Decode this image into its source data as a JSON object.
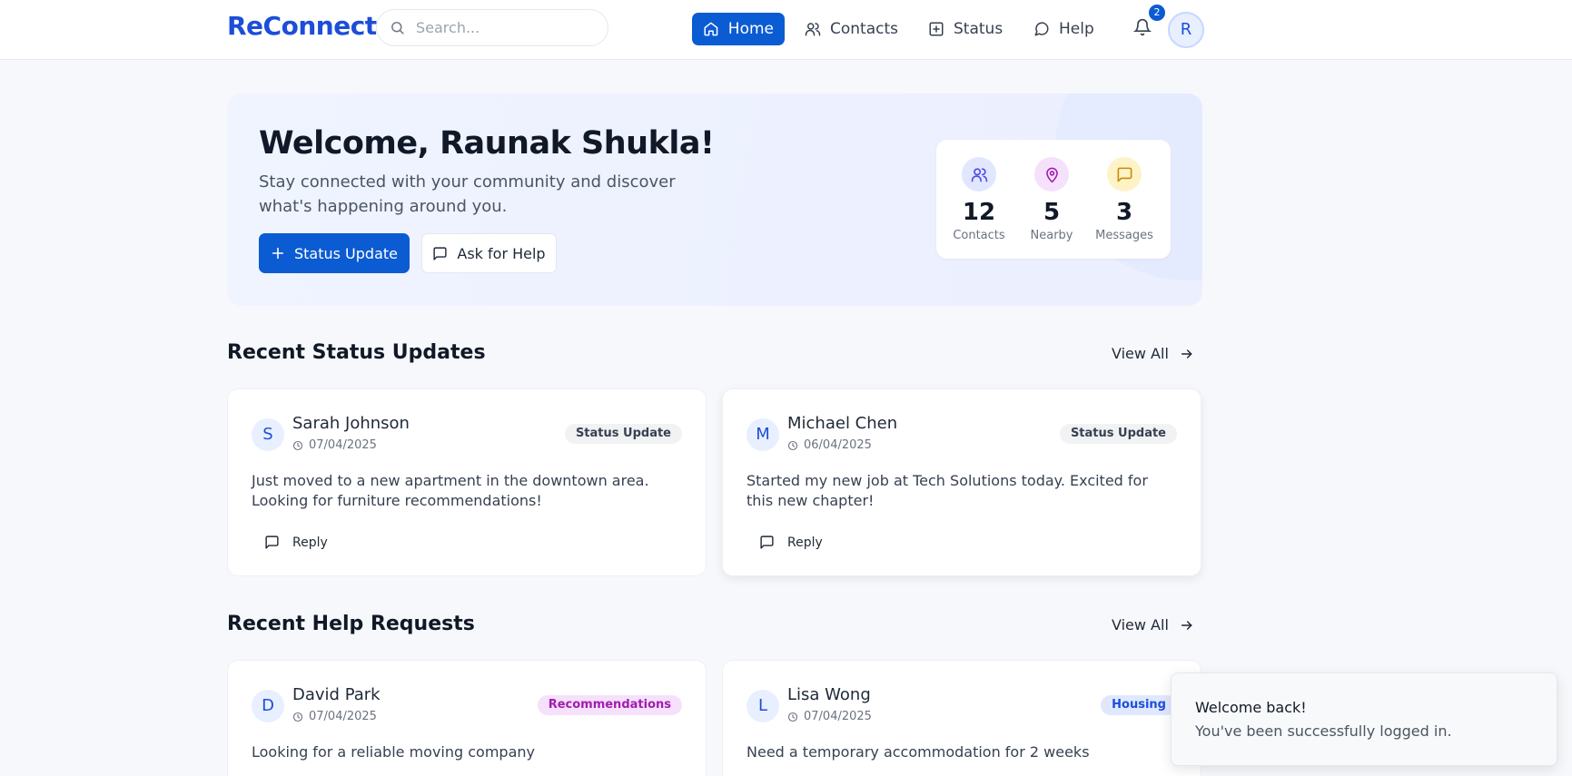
{
  "brand": "ReConnect",
  "search": {
    "placeholder": "Search..."
  },
  "nav": [
    {
      "label": "Home",
      "icon": "home-icon",
      "active": true
    },
    {
      "label": "Contacts",
      "icon": "users-icon"
    },
    {
      "label": "Status",
      "icon": "plus-square-icon"
    },
    {
      "label": "Help",
      "icon": "message-circle-icon"
    }
  ],
  "notifications": {
    "count": "2"
  },
  "user": {
    "initial": "R"
  },
  "hero": {
    "title": "Welcome, Raunak Shukla!",
    "subtitle": "Stay connected with your community and discover what's happening around you.",
    "primary_button": "Status Update",
    "secondary_button": "Ask for Help",
    "stats": [
      {
        "value": "12",
        "label": "Contacts",
        "icon": "users-icon",
        "color": "#4f46e5"
      },
      {
        "value": "5",
        "label": "Nearby",
        "icon": "map-pin-icon",
        "color": "#a21caf"
      },
      {
        "value": "3",
        "label": "Messages",
        "icon": "message-square-icon",
        "color": "#ca8a04"
      }
    ]
  },
  "status_section": {
    "title": "Recent Status Updates",
    "view_all": "View All",
    "cards": [
      {
        "initial": "S",
        "name": "Sarah Johnson",
        "date": "07/04/2025",
        "badge": "Status Update",
        "body": "Just moved to a new apartment in the downtown area. Looking for furniture recommendations!",
        "reply": "Reply"
      },
      {
        "initial": "M",
        "name": "Michael Chen",
        "date": "06/04/2025",
        "badge": "Status Update",
        "body": "Started my new job at Tech Solutions today. Excited for this new chapter!",
        "reply": "Reply"
      }
    ]
  },
  "help_section": {
    "title": "Recent Help Requests",
    "view_all": "View All",
    "cards": [
      {
        "initial": "D",
        "name": "David Park",
        "date": "07/04/2025",
        "badge": "Recommendations",
        "body": "Looking for a reliable moving company"
      },
      {
        "initial": "L",
        "name": "Lisa Wong",
        "date": "07/04/2025",
        "badge": "Housing",
        "body": "Need a temporary accommodation for 2 weeks"
      }
    ]
  },
  "toast": {
    "title": "Welcome back!",
    "message": "You've been successfully logged in."
  },
  "colors": {
    "accent": "#0b5bd3",
    "brand": "#1d4ed8"
  }
}
